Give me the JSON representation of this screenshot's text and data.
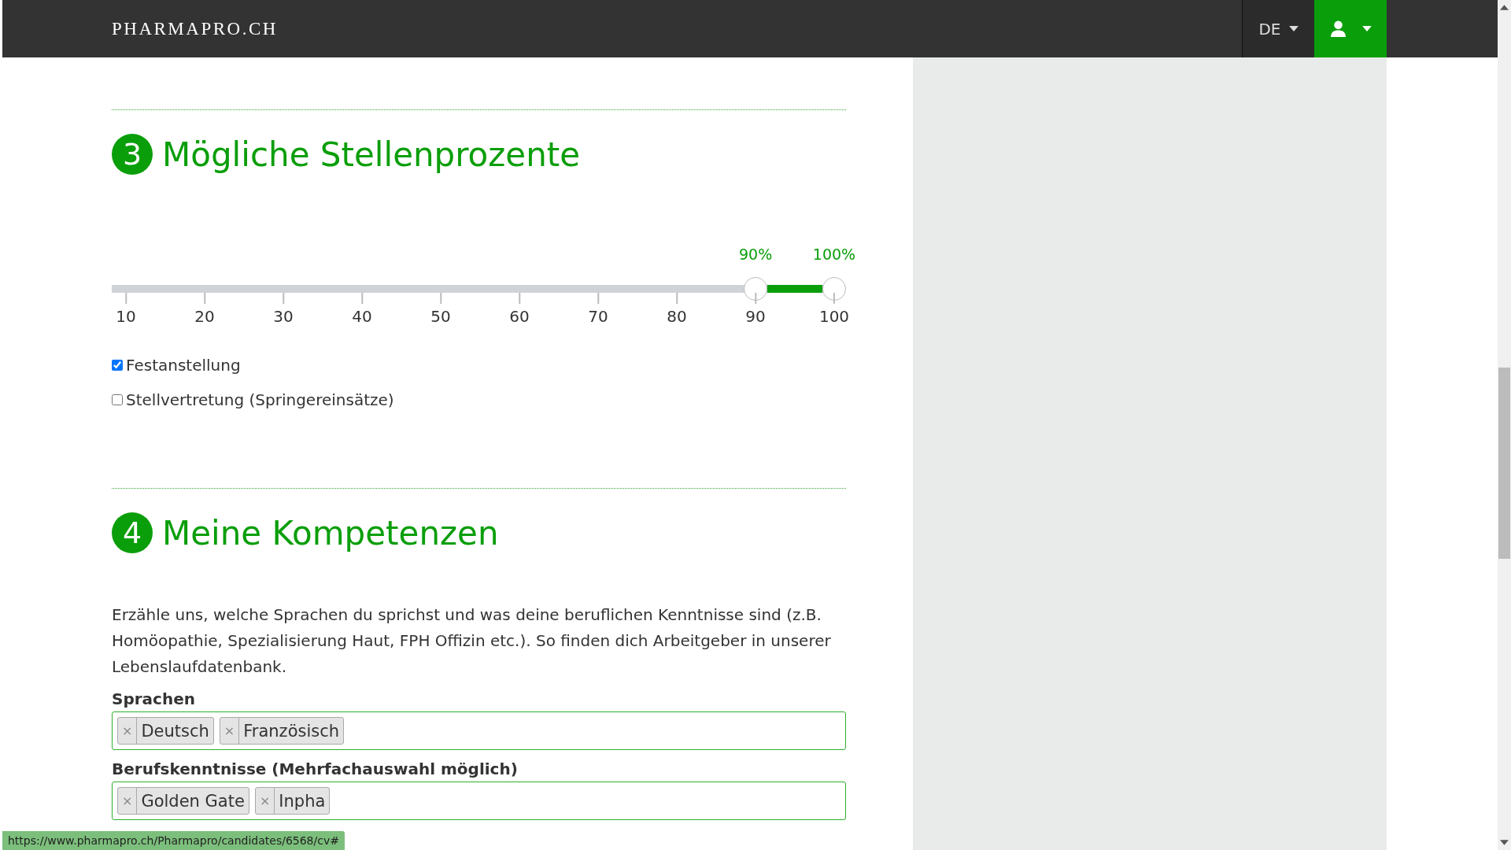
{
  "header": {
    "logo": "PHARMAPRO.CH",
    "language": "DE"
  },
  "sections": [
    {
      "number": "3",
      "title": "Mögliche Stellenprozente",
      "kind": "slider"
    },
    {
      "number": "4",
      "title": "Meine Kompetenzen",
      "kind": "skills"
    }
  ],
  "slider": {
    "thumbs": [
      {
        "label": "90%",
        "level": 0.889
      },
      {
        "label": "100%",
        "level": 1
      }
    ],
    "ticks": [
      "10",
      "20",
      "30",
      "40",
      "50",
      "60",
      "70",
      "80",
      "90",
      "100"
    ]
  },
  "options": [
    {
      "label": "Festanstellung",
      "checked": true
    },
    {
      "label": "Stellvertretung (Springereinsätze)",
      "checked": false
    }
  ],
  "intro": "Erzähle uns, welche Sprachen du sprichst und was deine beruflichen Kenntnisse sind (z.B. Homöopathie, Spezialisierung Haut, FPH Offizin etc.). So finden dich Arbeitgeber in unserer Lebenslaufdatenbank.",
  "fields": [
    {
      "label": "Sprachen",
      "tags": [
        {
          "remove": "×",
          "text": "Deutsch"
        },
        {
          "remove": "×",
          "text": "Französisch"
        }
      ]
    },
    {
      "label": "Berufskenntnisse (Mehrfachauswahl möglich)",
      "tags": [
        {
          "remove": "×",
          "text": "Golden Gate"
        },
        {
          "remove": "×",
          "text": "Inpha"
        }
      ]
    }
  ],
  "status_bar": "https://www.pharmapro.ch/Pharmapro/candidates/6568/cv#"
}
